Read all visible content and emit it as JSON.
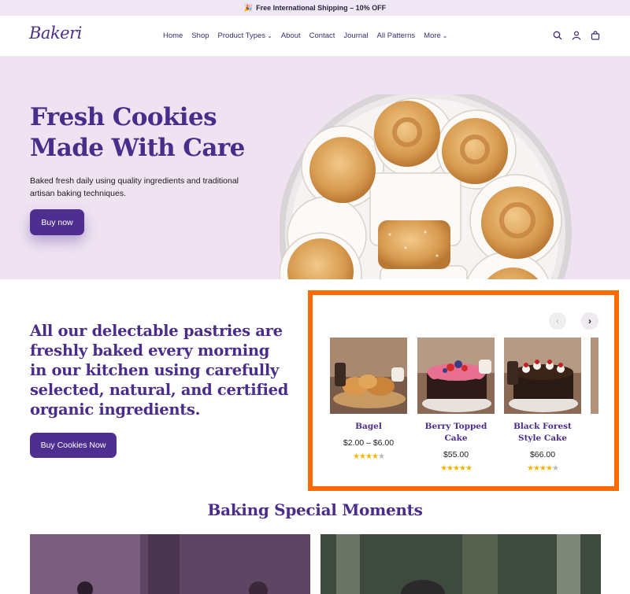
{
  "announcement": {
    "text": "Free International Shipping – 10% OFF",
    "icon": "party-popper-icon"
  },
  "header": {
    "logo": "Bakeri",
    "nav": [
      {
        "label": "Home",
        "has_dropdown": false
      },
      {
        "label": "Shop",
        "has_dropdown": false
      },
      {
        "label": "Product Types",
        "has_dropdown": true
      },
      {
        "label": "About",
        "has_dropdown": false
      },
      {
        "label": "Contact",
        "has_dropdown": false
      },
      {
        "label": "Journal",
        "has_dropdown": false
      },
      {
        "label": "All Patterns",
        "has_dropdown": false
      },
      {
        "label": "More",
        "has_dropdown": true
      }
    ],
    "icons": [
      "search-icon",
      "account-icon",
      "cart-icon"
    ]
  },
  "hero": {
    "title_line1": "Fresh Cookies",
    "title_line2": "Made With Care",
    "description": "Baked fresh daily using quality ingredients and traditional artisan baking techniques.",
    "button_label": "Buy now"
  },
  "pitch": {
    "text": "All our delectable pastries are freshly baked every morning in our kitchen using carefully selected, natural, and certified organic ingredients.",
    "button_label": "Buy Cookies Now"
  },
  "carousel": {
    "prev_icon": "chevron-left-icon",
    "next_icon": "chevron-right-icon",
    "products": [
      {
        "name": "Bagel",
        "price": "$2.00 – $6.00",
        "rating": 4
      },
      {
        "name": "Berry Topped Cake",
        "price": "$55.00",
        "rating": 5
      },
      {
        "name": "Black Forest Style Cake",
        "price": "$66.00",
        "rating": 4
      }
    ]
  },
  "section": {
    "title": "Baking Special Moments"
  },
  "colors": {
    "brand": "#4a2d8a",
    "hero_bg": "#efe3f2",
    "highlight": "#ff6a00",
    "star": "#f2b705"
  }
}
